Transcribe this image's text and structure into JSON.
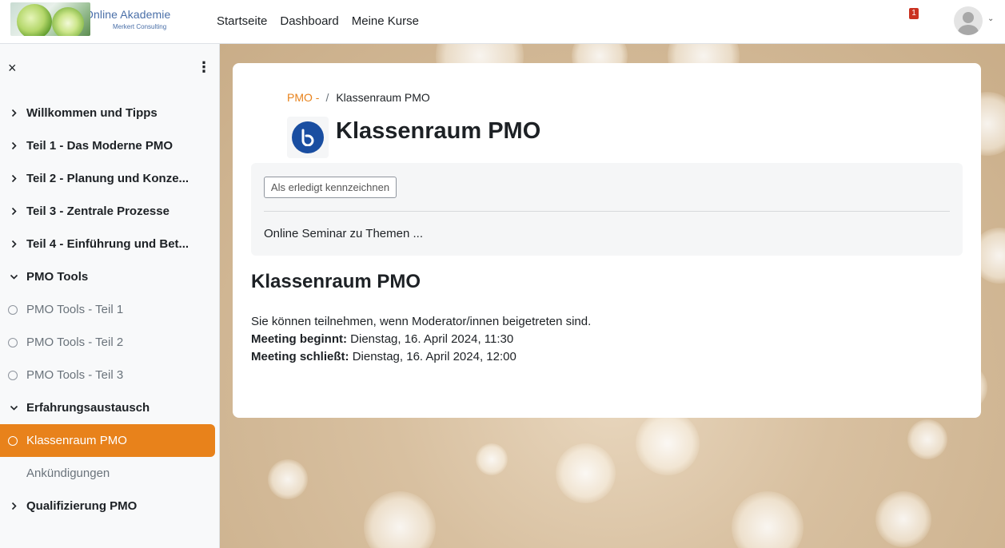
{
  "header": {
    "logo_title": "Online Akademie",
    "logo_subtitle": "Merkert Consulting",
    "nav": [
      "Startseite",
      "Dashboard",
      "Meine Kurse"
    ],
    "notification_count": "1"
  },
  "sidebar": {
    "close_icon": "×",
    "items": [
      {
        "label": "Willkommen und Tipps",
        "type": "section",
        "expanded": false
      },
      {
        "label": "Teil 1 - Das Moderne PMO",
        "type": "section",
        "expanded": false
      },
      {
        "label": "Teil 2 - Planung und Konze...",
        "type": "section",
        "expanded": false
      },
      {
        "label": "Teil 3 - Zentrale Prozesse",
        "type": "section",
        "expanded": false
      },
      {
        "label": "Teil 4 - Einführung und Bet...",
        "type": "section",
        "expanded": false
      },
      {
        "label": "PMO Tools",
        "type": "section",
        "expanded": true
      },
      {
        "label": "PMO Tools - Teil 1",
        "type": "activity"
      },
      {
        "label": "PMO Tools - Teil 2",
        "type": "activity"
      },
      {
        "label": "PMO Tools - Teil 3",
        "type": "activity"
      },
      {
        "label": "Erfahrungsaustausch",
        "type": "section",
        "expanded": true
      },
      {
        "label": "Klassenraum PMO",
        "type": "activity",
        "active": true
      },
      {
        "label": "Ankündigungen",
        "type": "plain"
      },
      {
        "label": "Qualifizierung PMO",
        "type": "section",
        "expanded": false
      }
    ]
  },
  "breadcrumb": {
    "parent": "PMO -",
    "separator": "/",
    "current": "Klassenraum PMO"
  },
  "page": {
    "title": "Klassenraum PMO",
    "mark_done_label": "Als erledigt kennzeichnen",
    "description": "Online Seminar zu Themen ...",
    "section_title": "Klassenraum PMO",
    "join_info": "Sie können teilnehmen, wenn Moderator/innen beigetreten sind.",
    "meeting_start_label": "Meeting beginnt:",
    "meeting_start_value": "Dienstag, 16. April 2024, 11:30",
    "meeting_end_label": "Meeting schließt:",
    "meeting_end_value": "Dienstag, 16. April 2024, 12:00"
  },
  "colors": {
    "accent": "#e8821b",
    "bbb_blue": "#1a4ea1",
    "notification_red": "#ca3120"
  }
}
